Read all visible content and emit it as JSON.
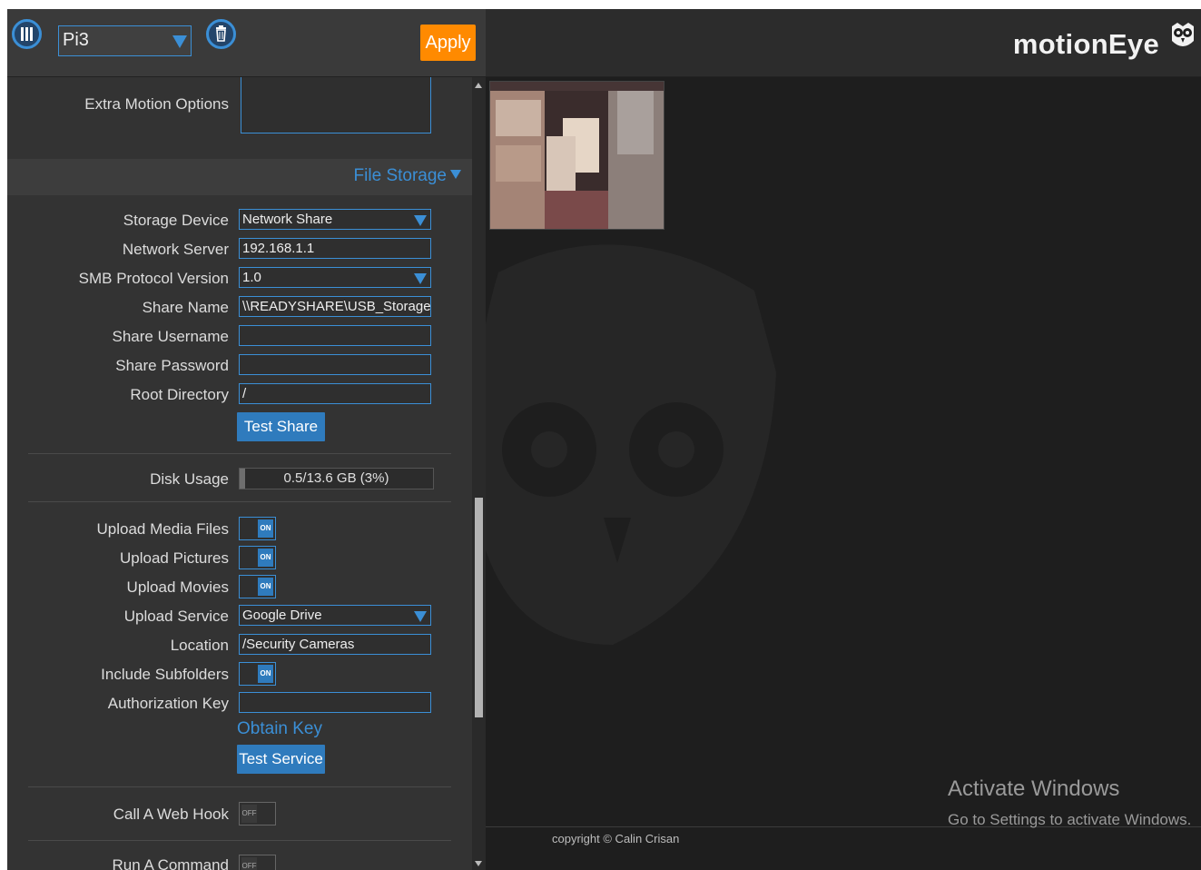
{
  "topbar": {
    "camera_selected": "Pi3",
    "apply_label": "Apply",
    "brand": "motionEye"
  },
  "panel": {
    "extra_motion_options_label": "Extra Motion Options",
    "section_title": "File Storage",
    "storage_device_label": "Storage Device",
    "storage_device_value": "Network Share",
    "network_server_label": "Network Server",
    "network_server_value": "192.168.1.1",
    "smb_version_label": "SMB Protocol Version",
    "smb_version_value": "1.0",
    "share_name_label": "Share Name",
    "share_name_value": "\\\\READYSHARE\\USB_Storage",
    "share_username_label": "Share Username",
    "share_username_value": "",
    "share_password_label": "Share Password",
    "share_password_value": "",
    "root_directory_label": "Root Directory",
    "root_directory_value": "/",
    "test_share_label": "Test Share",
    "disk_usage_label": "Disk Usage",
    "disk_usage_value": "0.5/13.6 GB (3%)",
    "disk_usage_fraction": 0.03,
    "upload_media_files_label": "Upload Media Files",
    "upload_pictures_label": "Upload Pictures",
    "upload_movies_label": "Upload Movies",
    "upload_service_label": "Upload Service",
    "upload_service_value": "Google Drive",
    "location_label": "Location",
    "location_value": "/Security Cameras",
    "include_subfolders_label": "Include Subfolders",
    "authorization_key_label": "Authorization Key",
    "authorization_key_value": "",
    "obtain_key_label": "Obtain Key",
    "test_service_label": "Test Service",
    "call_web_hook_label": "Call A Web Hook",
    "run_command_label": "Run A Command",
    "toggle_on_text": "ON",
    "toggle_off_text": "OFF"
  },
  "footer": {
    "copyright": "copyright © Calin Crisan",
    "activate_title": "Activate Windows",
    "activate_sub": "Go to Settings to activate Windows."
  },
  "colors": {
    "accent": "#3b8fd6",
    "apply": "#ff8a00",
    "background": "#1e1e1e",
    "panel": "#333333"
  },
  "icons": [
    "menu-icon",
    "dropdown-arrow-icon",
    "trash-icon",
    "owl-logo-icon",
    "owl-watermark-icon"
  ]
}
